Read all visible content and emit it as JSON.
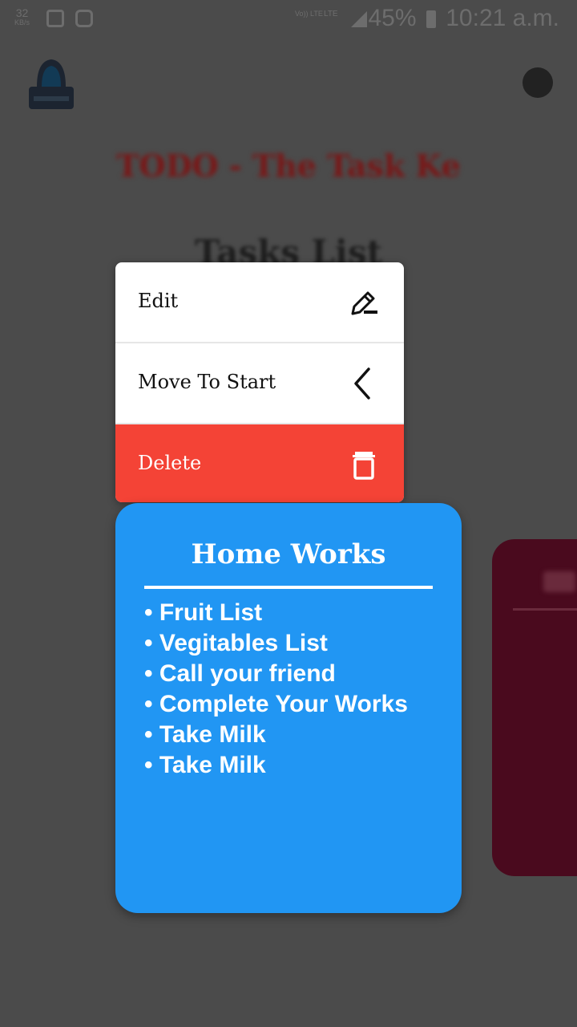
{
  "status_bar": {
    "speed": "32",
    "speed_unit": "KB/s",
    "volte_label": "Vo)) LTE",
    "lte_label": "LTE",
    "battery": "45%",
    "time": "10:21 a.m."
  },
  "app": {
    "title": "TODO - The Task Ke",
    "heading": "Tasks List"
  },
  "context_menu": {
    "items": [
      {
        "label": "Edit",
        "icon": "edit-icon"
      },
      {
        "label": "Move To Start",
        "icon": "chevron-left-icon"
      },
      {
        "label": "Delete",
        "icon": "trash-icon"
      }
    ],
    "delete_color": "#f44336"
  },
  "task_card": {
    "title": "Home Works",
    "color": "#2196f3",
    "items": [
      "• Fruit List",
      "• Vegitables List",
      "• Call your friend",
      "• Complete Your Works",
      "• Take Milk",
      "• Take Milk"
    ]
  },
  "colors": {
    "overlay": "#4b4b4b",
    "background_card": "#4a0a1e"
  }
}
